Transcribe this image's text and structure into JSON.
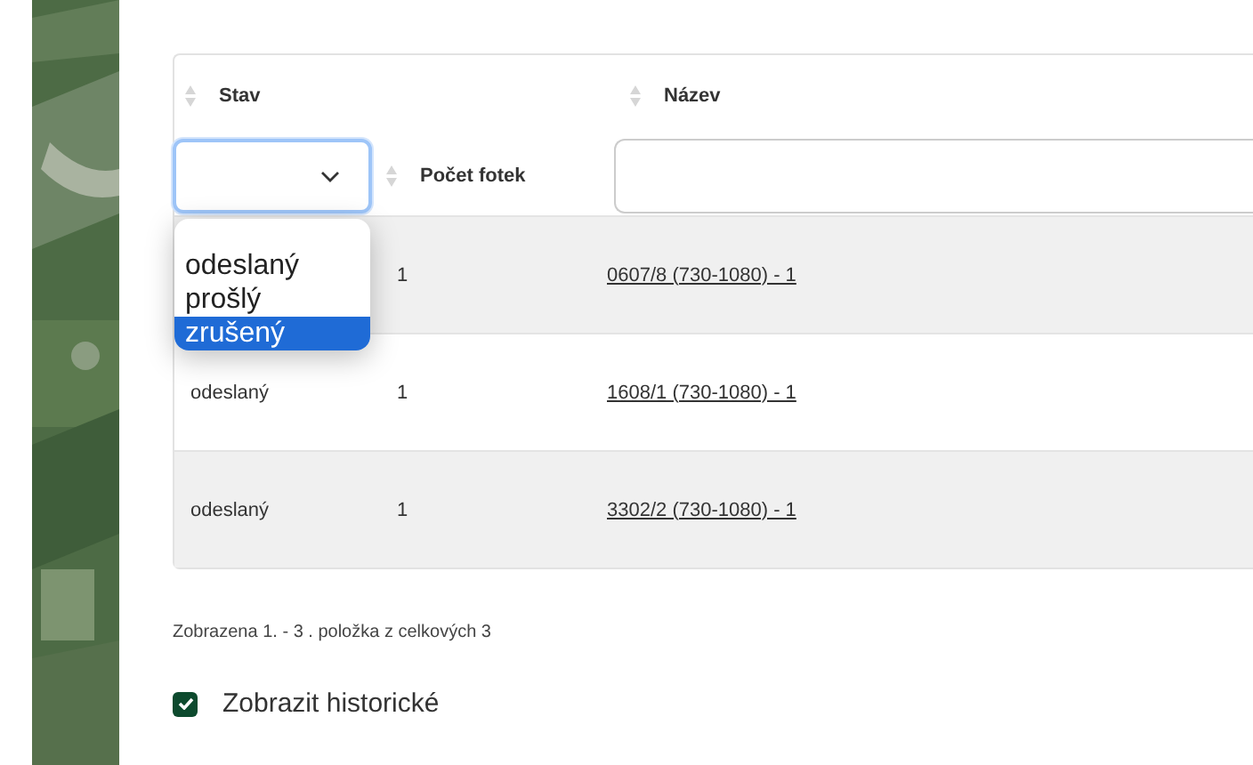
{
  "table": {
    "columns": [
      {
        "label": "Stav",
        "filter": {
          "kind": "select",
          "expanded": true,
          "options": [
            {
              "label": "odeslaný",
              "selected": false
            },
            {
              "label": "prošlý",
              "selected": false
            },
            {
              "label": "zrušený",
              "selected": true
            }
          ]
        }
      },
      {
        "label": "Počet fotek"
      },
      {
        "label": "Název",
        "filter": {
          "kind": "text"
        }
      }
    ],
    "rows": [
      {
        "count": "1",
        "name": "0607/8 (730-1080) - 1"
      },
      {
        "status": "odeslaný",
        "count": "1",
        "name": "1608/1 (730-1080) - 1"
      },
      {
        "status": "odeslaný",
        "count": "1",
        "name": "3302/2 (730-1080) - 1"
      }
    ]
  },
  "pagination": "Zobrazena 1. - 3 . položka z celkových 3",
  "show_history": {
    "label": "Zobrazit historické",
    "checked": true
  }
}
